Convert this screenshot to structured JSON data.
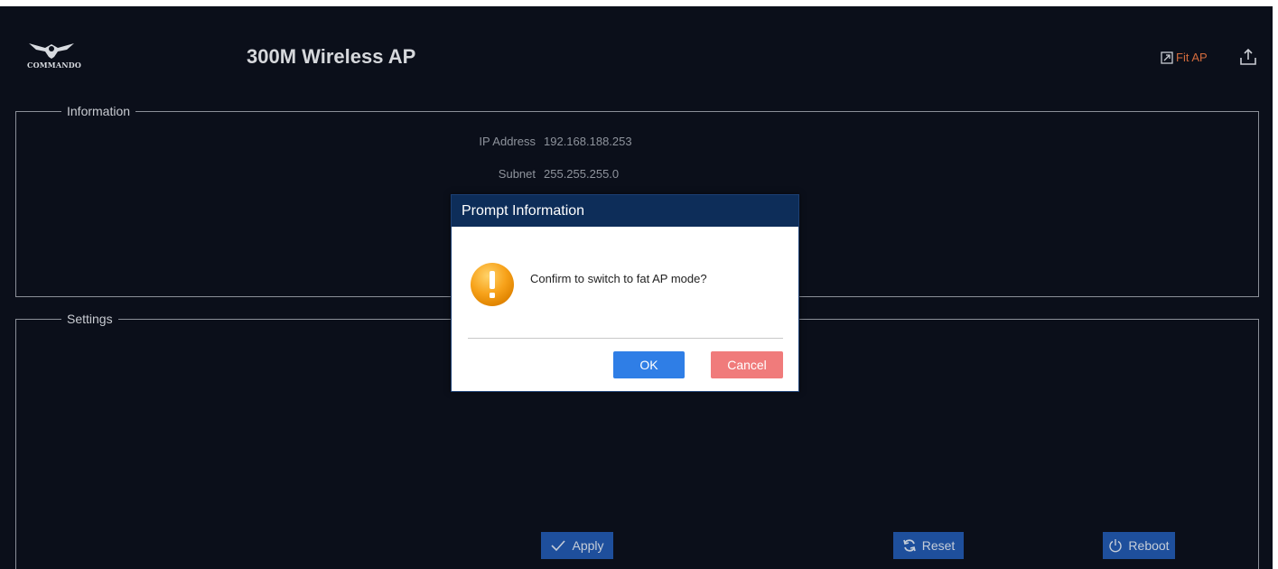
{
  "header": {
    "logo_text": "COMMANDO",
    "title": "300M Wireless AP",
    "mode_link": "Fit AP",
    "mode_icon": "external-link-icon",
    "export_icon": "upload-icon",
    "mode_color": "#d26a3c"
  },
  "information": {
    "legend": "Information",
    "rows": [
      {
        "label": "IP Address",
        "value": "192.168.188.253"
      },
      {
        "label": "Subnet",
        "value": "255.255.255.0"
      }
    ]
  },
  "settings": {
    "legend": "Settings"
  },
  "actions": {
    "apply": "Apply",
    "reset": "Reset",
    "reboot": "Reboot"
  },
  "dialog": {
    "title": "Prompt Information",
    "message": "Confirm to switch to fat AP mode?",
    "icon": "warning-icon",
    "ok": "OK",
    "cancel": "Cancel"
  }
}
